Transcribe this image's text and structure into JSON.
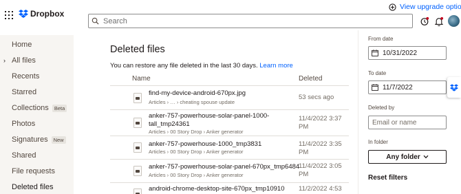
{
  "header": {
    "logo_text": "Dropbox",
    "upgrade_label": "View upgrade options",
    "search_placeholder": "Search"
  },
  "sidebar": {
    "items": [
      {
        "label": "Home"
      },
      {
        "label": "All files"
      },
      {
        "label": "Recents"
      },
      {
        "label": "Starred"
      },
      {
        "label": "Collections",
        "badge": "Beta"
      },
      {
        "label": "Photos"
      },
      {
        "label": "Signatures",
        "badge": "New"
      },
      {
        "label": "Shared"
      },
      {
        "label": "File requests"
      },
      {
        "label": "Deleted files"
      }
    ]
  },
  "main": {
    "title": "Deleted files",
    "subtitle": "You can restore any file deleted in the last 30 days.",
    "learn_more": "Learn more",
    "columns": {
      "name": "Name",
      "deleted": "Deleted"
    },
    "rows": [
      {
        "name": "find-my-device-android-670px.jpg",
        "path": "Articles  ›  …  ›  cheating spouse update",
        "date": "53 secs ago"
      },
      {
        "name": "anker-757-powerhouse-solar-panel-1000-tall_tmp24361",
        "path": "Articles  ›  00 Story Drop  ›  Anker generator",
        "date": "11/4/2022 3:37 PM"
      },
      {
        "name": "anker-757-powerhouse-1000_tmp3831",
        "path": "Articles  ›  00 Story Drop  ›  Anker generator",
        "date": "11/4/2022 3:35 PM"
      },
      {
        "name": "anker-757-powerhouse-solar-panel-670px_tmp6484",
        "path": "Articles  ›  00 Story Drop  ›  Anker generator",
        "date": "11/4/2022 3:05 PM"
      },
      {
        "name": "android-chrome-desktop-site-670px_tmp10910",
        "path": "",
        "date": "11/2/2022 4:53"
      }
    ]
  },
  "filters": {
    "from_label": "From date",
    "from_value": "10/31/2022",
    "to_label": "To date",
    "to_value": "11/7/2022",
    "deleted_by_label": "Deleted by",
    "deleted_by_placeholder": "Email or name",
    "folder_label": "In folder",
    "folder_button": "Any folder",
    "reset_label": "Reset filters"
  },
  "colors": {
    "accent": "#0061fe",
    "sidebar_bg": "#f7f5f2"
  }
}
